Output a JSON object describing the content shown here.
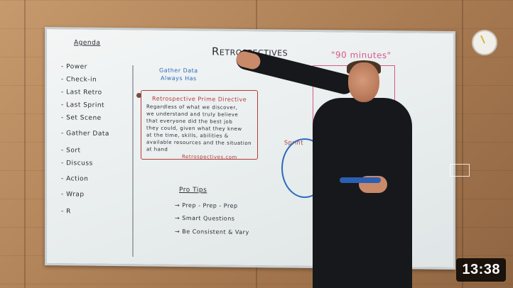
{
  "video": {
    "duration": "13:38"
  },
  "whiteboard": {
    "title": "Retrospectives",
    "time_note": "\"90 minutes\"",
    "agenda_heading": "Agenda",
    "agenda_items": [
      "- Power",
      "- Check-in",
      "- Last Retro",
      "- Last Sprint",
      "- Set Scene",
      "- Gather Data",
      "- Sort",
      "- Discuss",
      "- Action",
      "- Wrap",
      "- R"
    ],
    "blue_note_lines": [
      "Gather Data",
      "Always Has"
    ],
    "quote_heading": "Retrospective Prime Directive",
    "quote_lines": [
      "Regardless of what we discover,",
      "we understand and truly believe",
      "that everyone did the best job",
      "they could, given what they knew",
      "at the time, skills, abilities &",
      "available resources and the situation",
      "at hand"
    ],
    "quote_source": "Retrospectives.com",
    "pro_tips_heading": "Pro Tips",
    "pro_tips": [
      "→ Prep - Prep - Prep",
      "→ Smart Questions",
      "→ Be Consistent & Vary"
    ],
    "cycle_label": "Sprint"
  },
  "colors": {
    "timestamp_bg": "#000000",
    "board_ink": "#2b2b36",
    "quote_ink": "#b33a3a",
    "marker_blue": "#2b6bbf",
    "time_pink": "#d65a8a"
  }
}
